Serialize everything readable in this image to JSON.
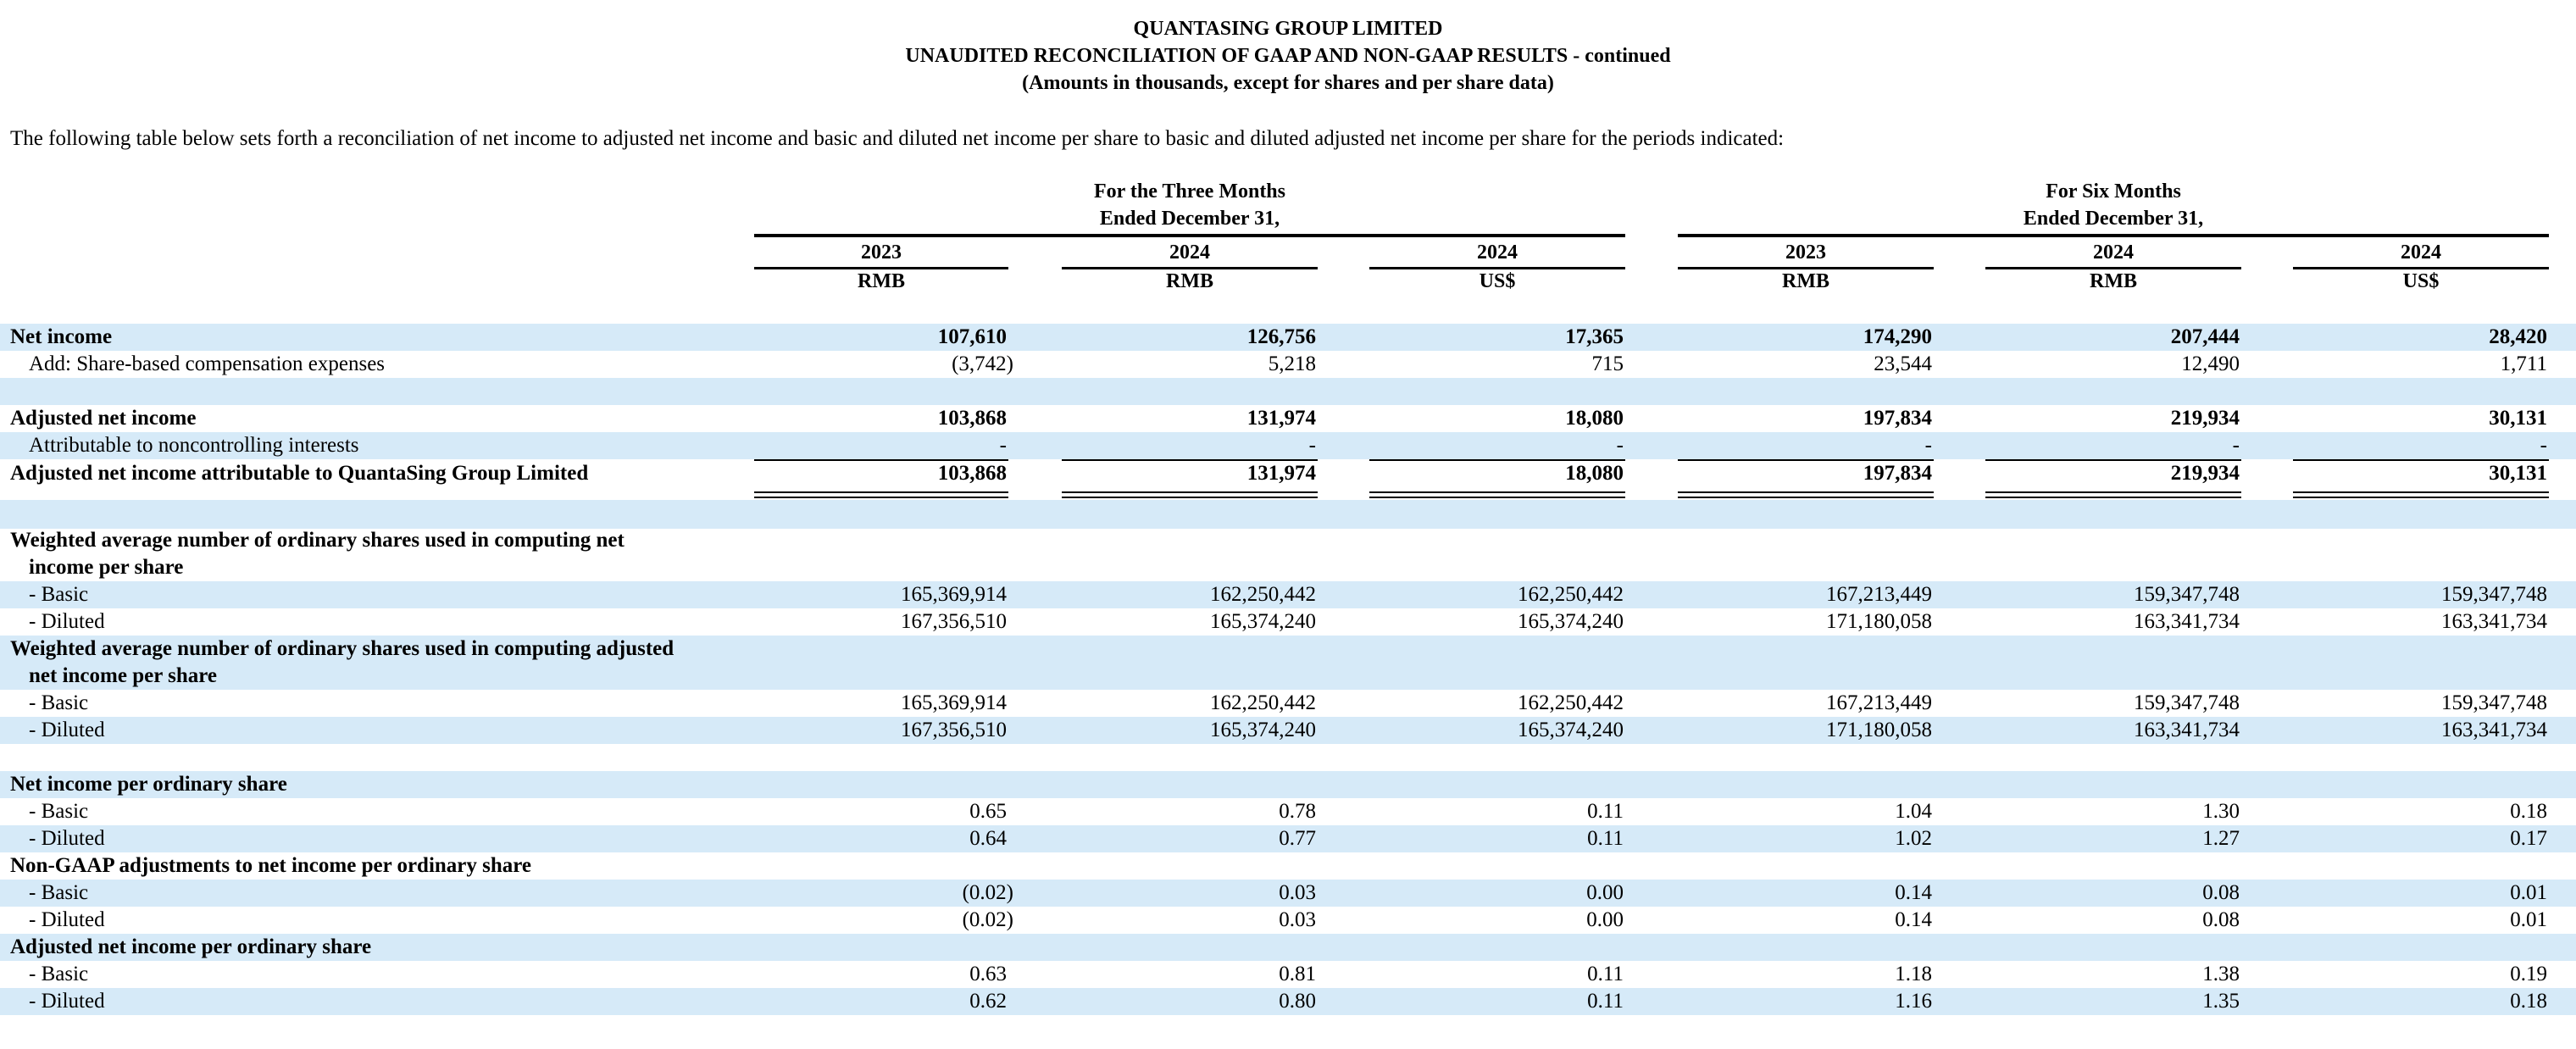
{
  "header": {
    "company": "QUANTASING GROUP LIMITED",
    "title": "UNAUDITED RECONCILIATION OF GAAP AND NON-GAAP RESULTS - continued",
    "subtitle": "(Amounts in thousands, except for shares and per share data)"
  },
  "intro": "The following table below sets forth a reconciliation of net income to adjusted net income and basic and diluted net income per share to basic and diluted adjusted net income per share for the periods indicated:",
  "groups": [
    {
      "line1": "For the Three Months",
      "line2": "Ended December 31,"
    },
    {
      "line1": "For Six Months",
      "line2": "Ended December 31,"
    }
  ],
  "columns": [
    {
      "year": "2023",
      "currency": "RMB"
    },
    {
      "year": "2024",
      "currency": "RMB"
    },
    {
      "year": "2024",
      "currency": "US$"
    },
    {
      "year": "2023",
      "currency": "RMB"
    },
    {
      "year": "2024",
      "currency": "RMB"
    },
    {
      "year": "2024",
      "currency": "US$"
    }
  ],
  "rows": {
    "net_income": {
      "label": "Net income",
      "values": [
        "107,610",
        "126,756",
        "17,365",
        "174,290",
        "207,444",
        "28,420"
      ]
    },
    "sbc": {
      "label": "Add: Share-based compensation expenses",
      "values": [
        "(3,742)",
        "5,218",
        "715",
        "23,544",
        "12,490",
        "1,711"
      ]
    },
    "adj_net_income": {
      "label": "Adjusted net income",
      "values": [
        "103,868",
        "131,974",
        "18,080",
        "197,834",
        "219,934",
        "30,131"
      ]
    },
    "nci": {
      "label": "Attributable to noncontrolling interests",
      "values": [
        "-",
        "-",
        "-",
        "-",
        "-",
        "-"
      ]
    },
    "adj_attrib": {
      "label": "Adjusted net income attributable to QuantaSing Group Limited",
      "values": [
        "103,868",
        "131,974",
        "18,080",
        "197,834",
        "219,934",
        "30,131"
      ]
    },
    "wa_net_head": {
      "line1": "Weighted average number of ordinary shares used in computing net",
      "line2": "income per share"
    },
    "wa_net_basic": {
      "label": "- Basic",
      "values": [
        "165,369,914",
        "162,250,442",
        "162,250,442",
        "167,213,449",
        "159,347,748",
        "159,347,748"
      ]
    },
    "wa_net_diluted": {
      "label": "- Diluted",
      "values": [
        "167,356,510",
        "165,374,240",
        "165,374,240",
        "171,180,058",
        "163,341,734",
        "163,341,734"
      ]
    },
    "wa_adj_head": {
      "line1": "Weighted average number of ordinary shares used in computing adjusted",
      "line2": "net income per share"
    },
    "wa_adj_basic": {
      "label": "- Basic",
      "values": [
        "165,369,914",
        "162,250,442",
        "162,250,442",
        "167,213,449",
        "159,347,748",
        "159,347,748"
      ]
    },
    "wa_adj_diluted": {
      "label": "- Diluted",
      "values": [
        "167,356,510",
        "165,374,240",
        "165,374,240",
        "171,180,058",
        "163,341,734",
        "163,341,734"
      ]
    },
    "eps_head": {
      "label": "Net income per ordinary share"
    },
    "eps_basic": {
      "label": "- Basic",
      "values": [
        "0.65",
        "0.78",
        "0.11",
        "1.04",
        "1.30",
        "0.18"
      ]
    },
    "eps_diluted": {
      "label": "- Diluted",
      "values": [
        "0.64",
        "0.77",
        "0.11",
        "1.02",
        "1.27",
        "0.17"
      ]
    },
    "nongaap_head": {
      "label": "Non-GAAP adjustments to net income per ordinary share"
    },
    "nongaap_basic": {
      "label": "- Basic",
      "values": [
        "(0.02)",
        "0.03",
        "0.00",
        "0.14",
        "0.08",
        "0.01"
      ]
    },
    "nongaap_diluted": {
      "label": "- Diluted",
      "values": [
        "(0.02)",
        "0.03",
        "0.00",
        "0.14",
        "0.08",
        "0.01"
      ]
    },
    "adj_eps_head": {
      "label": "Adjusted net income per ordinary share"
    },
    "adj_eps_basic": {
      "label": "- Basic",
      "values": [
        "0.63",
        "0.81",
        "0.11",
        "1.18",
        "1.38",
        "0.19"
      ]
    },
    "adj_eps_diluted": {
      "label": "- Diluted",
      "values": [
        "0.62",
        "0.80",
        "0.11",
        "1.16",
        "1.35",
        "0.18"
      ]
    }
  }
}
